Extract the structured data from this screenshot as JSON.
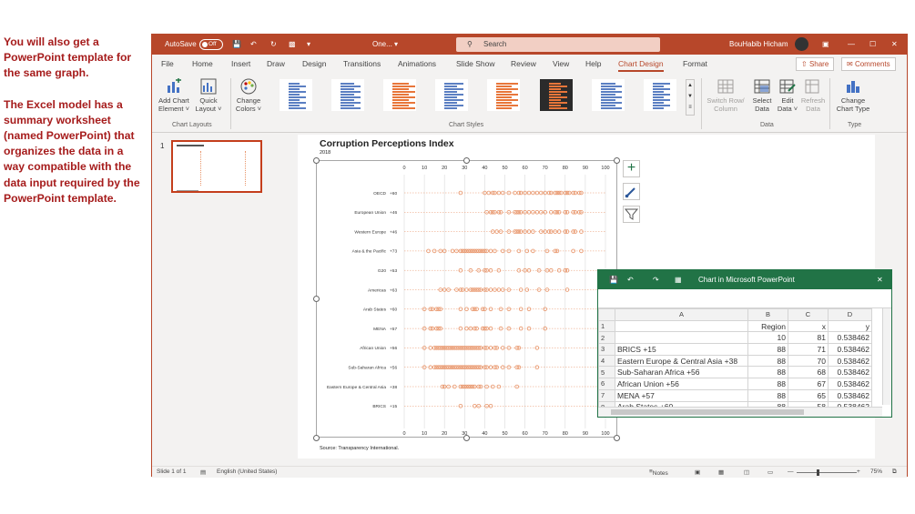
{
  "side_note": {
    "para1": "You will also get a PowerPoint template for the same graph.",
    "para2": "The Excel model has a summary worksheet (named PowerPoint) that organizes the data in a way compatible with the data input required by the PowerPoint template."
  },
  "titlebar": {
    "autosave": "AutoSave",
    "autosave_state": "Off",
    "filename": "One...",
    "search_placeholder": "Search",
    "user": "BouHabib Hicham"
  },
  "tabs": [
    "File",
    "Home",
    "Insert",
    "Draw",
    "Design",
    "Transitions",
    "Animations",
    "Slide Show",
    "Review",
    "View",
    "Help",
    "Chart Design",
    "Format"
  ],
  "active_tab": "Chart Design",
  "share_label": "Share",
  "comments_label": "Comments",
  "ribbon": {
    "add_chart_element": [
      "Add Chart",
      "Element ˅"
    ],
    "quick_layout": [
      "Quick",
      "Layout ˅"
    ],
    "chart_layouts_label": "Chart Layouts",
    "change_colors": [
      "Change",
      "Colors ˅"
    ],
    "chart_styles_label": "Chart Styles",
    "switch_row_column": [
      "Switch Row/",
      "Column"
    ],
    "select_data": [
      "Select",
      "Data"
    ],
    "edit_data": [
      "Edit",
      "Data ˅"
    ],
    "refresh_data": [
      "Refresh",
      "Data"
    ],
    "data_label": "Data",
    "change_chart_type": [
      "Change",
      "Chart Type"
    ],
    "type_label": "Type"
  },
  "slide_number": "1",
  "chart_data": {
    "type": "scatter",
    "title": "Corruption Perceptions Index",
    "subtitle": "2018",
    "source": "Source: Transparency International.",
    "xlim": [
      0,
      100
    ],
    "x_ticks": [
      0,
      10,
      20,
      30,
      40,
      50,
      60,
      70,
      80,
      90,
      100
    ],
    "categories": [
      {
        "name": "OECD",
        "label": "+60",
        "values": [
          28,
          40,
          42,
          44,
          45,
          47,
          49,
          52,
          55,
          57,
          58,
          60,
          62,
          64,
          66,
          68,
          70,
          72,
          73,
          75,
          76,
          77,
          78,
          80,
          81,
          82,
          84,
          85,
          87,
          88
        ]
      },
      {
        "name": "European Union",
        "label": "+46",
        "values": [
          41,
          43,
          44,
          45,
          47,
          48,
          52,
          55,
          56,
          57,
          58,
          60,
          62,
          64,
          66,
          68,
          70,
          73,
          75,
          76,
          77,
          80,
          81,
          84,
          85,
          87,
          88
        ]
      },
      {
        "name": "Western Europe",
        "label": "+46",
        "values": [
          44,
          46,
          48,
          52,
          55,
          56,
          57,
          58,
          60,
          62,
          64,
          68,
          70,
          72,
          73,
          75,
          77,
          80,
          81,
          84,
          85,
          88
        ]
      },
      {
        "name": "Asia & the Pacific",
        "label": "+73",
        "values": [
          12,
          15,
          18,
          20,
          24,
          26,
          28,
          29,
          30,
          31,
          32,
          33,
          34,
          35,
          36,
          37,
          38,
          39,
          40,
          41,
          43,
          45,
          49,
          52,
          57,
          61,
          64,
          71,
          75,
          76,
          84,
          88
        ]
      },
      {
        "name": "G20",
        "label": "+53",
        "values": [
          28,
          33,
          37,
          40,
          41,
          43,
          47,
          57,
          60,
          62,
          67,
          71,
          73,
          77,
          80,
          81
        ]
      },
      {
        "name": "Americas",
        "label": "+63",
        "values": [
          18,
          20,
          22,
          26,
          28,
          29,
          31,
          33,
          34,
          35,
          36,
          37,
          38,
          40,
          41,
          43,
          45,
          47,
          49,
          52,
          58,
          61,
          67,
          71,
          81
        ]
      },
      {
        "name": "Arab States",
        "label": "+60",
        "values": [
          10,
          13,
          14,
          16,
          17,
          18,
          28,
          31,
          34,
          35,
          36,
          39,
          40,
          43,
          48,
          52,
          58,
          62,
          70
        ]
      },
      {
        "name": "MENA",
        "label": "+57",
        "values": [
          10,
          13,
          14,
          16,
          17,
          18,
          28,
          31,
          33,
          35,
          36,
          39,
          40,
          41,
          43,
          48,
          52,
          58,
          62,
          70
        ]
      },
      {
        "name": "African Union",
        "label": "+56",
        "values": [
          10,
          13,
          15,
          16,
          17,
          18,
          19,
          20,
          21,
          22,
          23,
          24,
          25,
          26,
          27,
          28,
          29,
          30,
          31,
          32,
          33,
          34,
          35,
          36,
          37,
          38,
          40,
          41,
          43,
          45,
          46,
          49,
          52,
          56,
          57,
          66
        ]
      },
      {
        "name": "Sub-Saharan Africa",
        "label": "+56",
        "values": [
          10,
          13,
          15,
          16,
          17,
          18,
          19,
          20,
          21,
          22,
          23,
          24,
          25,
          26,
          27,
          28,
          29,
          30,
          31,
          32,
          33,
          34,
          35,
          36,
          37,
          38,
          40,
          41,
          43,
          45,
          46,
          49,
          52,
          56,
          57,
          66
        ]
      },
      {
        "name": "Eastern Europe & Central Asia",
        "label": "+38",
        "values": [
          19,
          20,
          22,
          25,
          28,
          29,
          30,
          31,
          32,
          33,
          34,
          35,
          37,
          38,
          41,
          44,
          47,
          56
        ]
      },
      {
        "name": "BRICS",
        "label": "+15",
        "values": [
          28,
          35,
          37,
          41,
          43
        ]
      }
    ]
  },
  "excel": {
    "title": "Chart in Microsoft PowerPoint",
    "columns": [
      "A",
      "B",
      "C",
      "D"
    ],
    "rows": [
      [
        "1",
        "",
        "Region",
        "x",
        "y"
      ],
      [
        "2",
        "",
        "10",
        "81",
        "0.538462"
      ],
      [
        "3",
        "BRICS    +15",
        "88",
        "71",
        "0.538462"
      ],
      [
        "4",
        "Eastern Europe & Central Asia    +38",
        "88",
        "70",
        "0.538462"
      ],
      [
        "5",
        "Sub-Saharan Africa    +56",
        "88",
        "68",
        "0.538462"
      ],
      [
        "6",
        "African Union    +56",
        "88",
        "67",
        "0.538462"
      ],
      [
        "7",
        "MENA    +57",
        "88",
        "65",
        "0.538462"
      ],
      [
        "8",
        "Arab States    +60",
        "88",
        "58",
        "0.538462"
      ]
    ]
  },
  "status": {
    "slide": "Slide 1 of 1",
    "language": "English (United States)",
    "notes": "Notes",
    "zoom": "75%"
  },
  "colors": {
    "accent": "#b7472a",
    "marker": "#e8956a",
    "excel_green": "#217346"
  }
}
